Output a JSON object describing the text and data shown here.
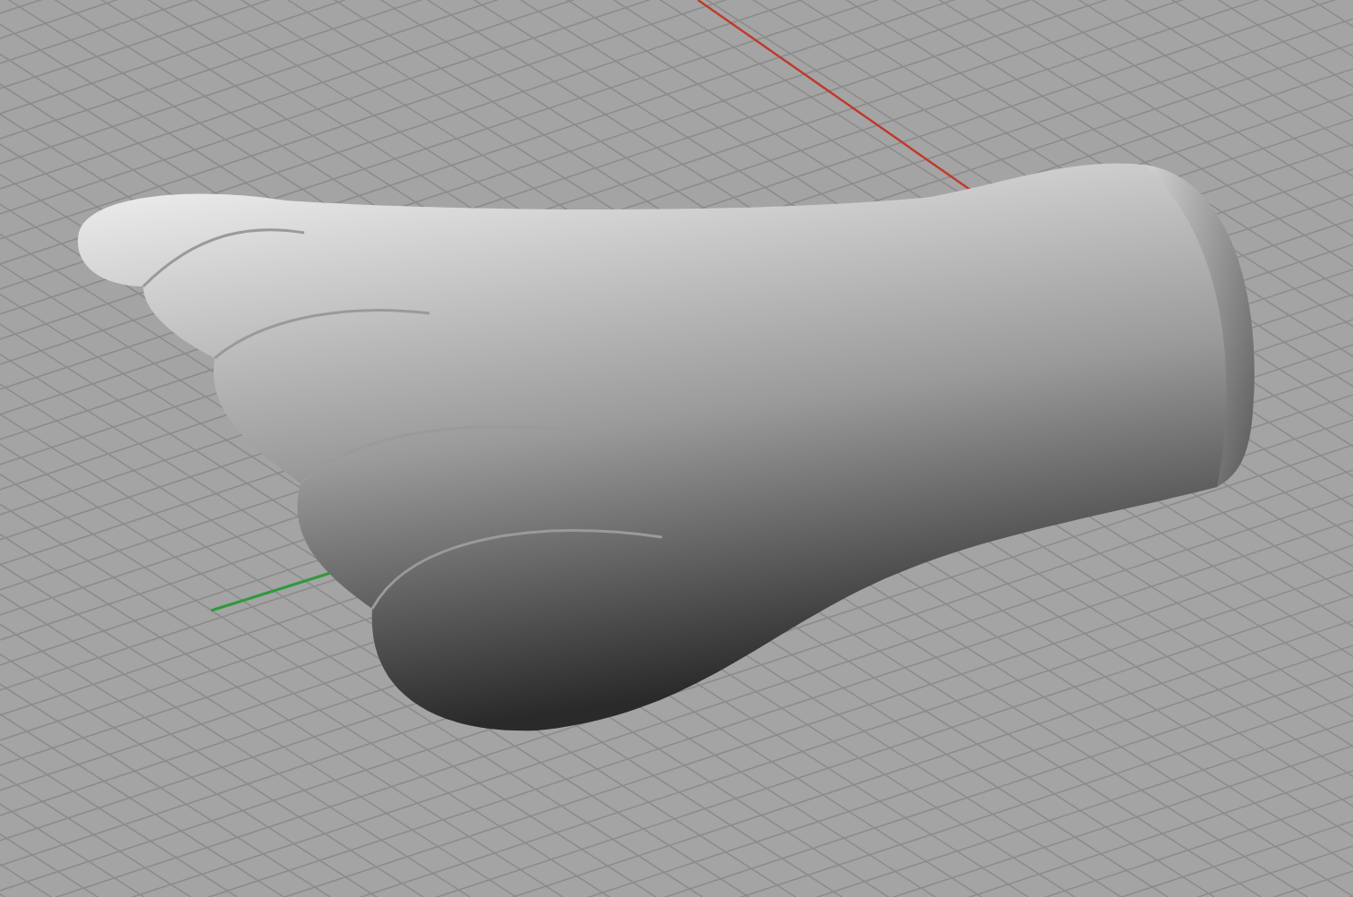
{
  "viewport": {
    "grid": true,
    "axes": true,
    "shaded": true
  }
}
